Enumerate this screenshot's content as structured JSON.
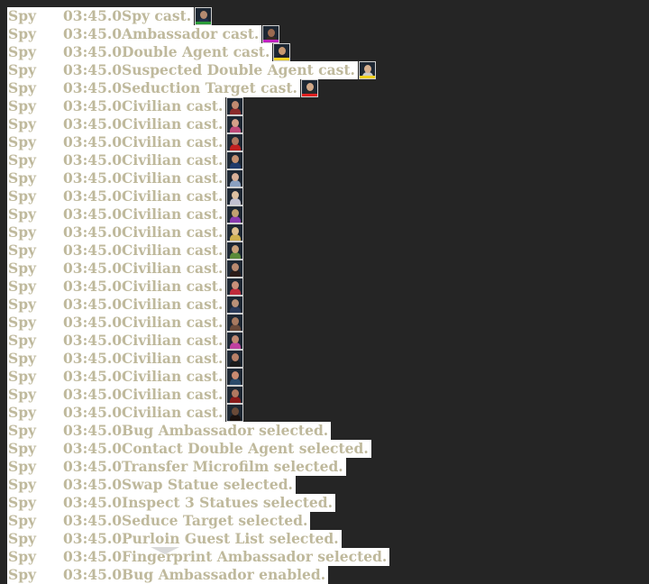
{
  "log": {
    "rows": [
      {
        "role": "Spy",
        "time": "03:45.0",
        "message": "Spy cast.",
        "portrait": {
          "icon": "spy-portrait-icon",
          "skin": "#b38a70",
          "outfit": "#23314f",
          "accent": "#2b9b3a"
        }
      },
      {
        "role": "Spy",
        "time": "03:45.0",
        "message": "Ambassador cast.",
        "portrait": {
          "icon": "ambassador-portrait-icon",
          "skin": "#9b6a50",
          "outfit": "#3a2a24",
          "accent": "#c020c0"
        }
      },
      {
        "role": "Spy",
        "time": "03:45.0",
        "message": "Double Agent cast.",
        "portrait": {
          "icon": "double-agent-portrait-icon",
          "skin": "#c89870",
          "outfit": "#1d1d28",
          "accent": "#f0d020"
        }
      },
      {
        "role": "Spy",
        "time": "03:45.0",
        "message": "Suspected Double Agent cast.",
        "portrait": {
          "icon": "suspected-double-agent-portrait-icon",
          "skin": "#d6b090",
          "outfit": "#c8c8c8",
          "accent": "#f0d020"
        }
      },
      {
        "role": "Spy",
        "time": "03:45.0",
        "message": "Seduction Target cast.",
        "portrait": {
          "icon": "seduction-target-portrait-icon",
          "skin": "#d0a888",
          "outfit": "#2a2a2a",
          "accent": "#e02020"
        }
      },
      {
        "role": "Spy",
        "time": "03:45.0",
        "message": "Civilian cast.",
        "portrait": {
          "icon": "civilian-portrait-icon",
          "skin": "#c08a70",
          "outfit": "#8a2a2a",
          "accent": ""
        }
      },
      {
        "role": "Spy",
        "time": "03:45.0",
        "message": "Civilian cast.",
        "portrait": {
          "icon": "civilian-portrait-icon",
          "skin": "#d4a088",
          "outfit": "#c04a7a",
          "accent": ""
        }
      },
      {
        "role": "Spy",
        "time": "03:45.0",
        "message": "Civilian cast.",
        "portrait": {
          "icon": "civilian-portrait-icon",
          "skin": "#b07860",
          "outfit": "#c02020",
          "accent": ""
        }
      },
      {
        "role": "Spy",
        "time": "03:45.0",
        "message": "Civilian cast.",
        "portrait": {
          "icon": "civilian-portrait-icon",
          "skin": "#c49070",
          "outfit": "#203a6a",
          "accent": ""
        }
      },
      {
        "role": "Spy",
        "time": "03:45.0",
        "message": "Civilian cast.",
        "portrait": {
          "icon": "civilian-portrait-icon",
          "skin": "#d8b098",
          "outfit": "#8aa0c0",
          "accent": ""
        }
      },
      {
        "role": "Spy",
        "time": "03:45.0",
        "message": "Civilian cast.",
        "portrait": {
          "icon": "civilian-portrait-icon",
          "skin": "#dcc0a0",
          "outfit": "#c0c0d0",
          "accent": ""
        }
      },
      {
        "role": "Spy",
        "time": "03:45.0",
        "message": "Civilian cast.",
        "portrait": {
          "icon": "civilian-portrait-icon",
          "skin": "#c0a070",
          "outfit": "#8a3ab0",
          "accent": ""
        }
      },
      {
        "role": "Spy",
        "time": "03:45.0",
        "message": "Civilian cast.",
        "portrait": {
          "icon": "civilian-portrait-icon",
          "skin": "#e0c090",
          "outfit": "#d0b050",
          "accent": ""
        }
      },
      {
        "role": "Spy",
        "time": "03:45.0",
        "message": "Civilian cast.",
        "portrait": {
          "icon": "civilian-portrait-icon",
          "skin": "#c8a078",
          "outfit": "#5a8a3a",
          "accent": ""
        }
      },
      {
        "role": "Spy",
        "time": "03:45.0",
        "message": "Civilian cast.",
        "portrait": {
          "icon": "civilian-portrait-icon",
          "skin": "#b88a70",
          "outfit": "#2a1a18",
          "accent": ""
        }
      },
      {
        "role": "Spy",
        "time": "03:45.0",
        "message": "Civilian cast.",
        "portrait": {
          "icon": "civilian-portrait-icon",
          "skin": "#c8907a",
          "outfit": "#c02a3a",
          "accent": ""
        }
      },
      {
        "role": "Spy",
        "time": "03:45.0",
        "message": "Civilian cast.",
        "portrait": {
          "icon": "civilian-portrait-icon",
          "skin": "#b89078",
          "outfit": "#2a3a5a",
          "accent": ""
        }
      },
      {
        "role": "Spy",
        "time": "03:45.0",
        "message": "Civilian cast.",
        "portrait": {
          "icon": "civilian-portrait-icon",
          "skin": "#a87a60",
          "outfit": "#6a4a3a",
          "accent": ""
        }
      },
      {
        "role": "Spy",
        "time": "03:45.0",
        "message": "Civilian cast.",
        "portrait": {
          "icon": "civilian-portrait-icon",
          "skin": "#c08870",
          "outfit": "#c040a0",
          "accent": ""
        }
      },
      {
        "role": "Spy",
        "time": "03:45.0",
        "message": "Civilian cast.",
        "portrait": {
          "icon": "civilian-portrait-icon",
          "skin": "#b88068",
          "outfit": "#1a1a1a",
          "accent": ""
        }
      },
      {
        "role": "Spy",
        "time": "03:45.0",
        "message": "Civilian cast.",
        "portrait": {
          "icon": "civilian-portrait-icon",
          "skin": "#c88a70",
          "outfit": "#2a4a6a",
          "accent": ""
        }
      },
      {
        "role": "Spy",
        "time": "03:45.0",
        "message": "Civilian cast.",
        "portrait": {
          "icon": "civilian-portrait-icon",
          "skin": "#b07860",
          "outfit": "#8a1a1a",
          "accent": ""
        }
      },
      {
        "role": "Spy",
        "time": "03:45.0",
        "message": "Civilian cast.",
        "portrait": {
          "icon": "civilian-portrait-icon",
          "skin": "#6a4a38",
          "outfit": "#1a1210",
          "accent": ""
        }
      },
      {
        "role": "Spy",
        "time": "03:45.0",
        "message": "Bug Ambassador selected.",
        "portrait": null
      },
      {
        "role": "Spy",
        "time": "03:45.0",
        "message": "Contact Double Agent selected.",
        "portrait": null
      },
      {
        "role": "Spy",
        "time": "03:45.0",
        "message": "Transfer Microfilm selected.",
        "portrait": null
      },
      {
        "role": "Spy",
        "time": "03:45.0",
        "message": "Swap Statue selected.",
        "portrait": null
      },
      {
        "role": "Spy",
        "time": "03:45.0",
        "message": "Inspect 3 Statues selected.",
        "portrait": null
      },
      {
        "role": "Spy",
        "time": "03:45.0",
        "message": "Seduce Target selected.",
        "portrait": null
      },
      {
        "role": "Spy",
        "time": "03:45.0",
        "message": "Purloin Guest List selected.",
        "portrait": null
      },
      {
        "role": "Spy",
        "time": "03:45.0",
        "message": "Fingerprint Ambassador selected.",
        "portrait": null
      },
      {
        "role": "Spy",
        "time": "03:45.0",
        "message": "Bug Ambassador enabled.",
        "portrait": null
      }
    ]
  },
  "colors": {
    "background": "#252525",
    "row_background": "#ffffff",
    "text": "#bfb99c"
  }
}
